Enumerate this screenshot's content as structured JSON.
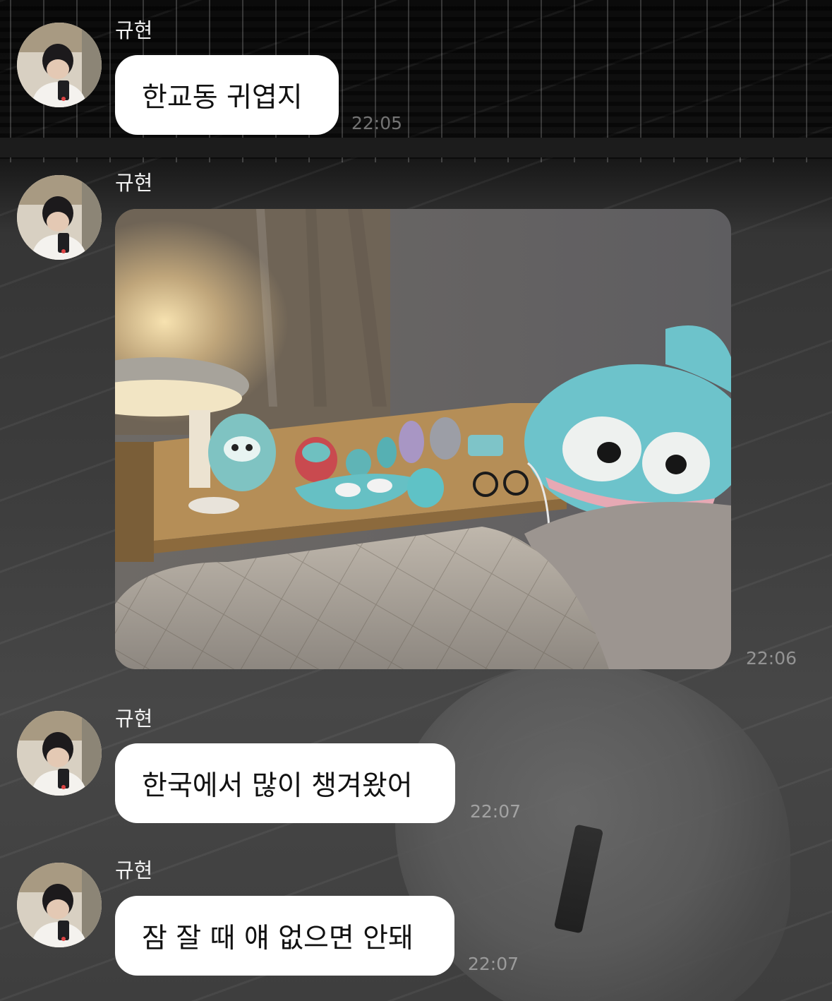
{
  "messages": [
    {
      "sender": "규현",
      "type": "text",
      "text": "한교동 귀엽지",
      "time": "22:05"
    },
    {
      "sender": "규현",
      "type": "image",
      "image_desc": "photo",
      "time": "22:06"
    },
    {
      "sender": "규현",
      "type": "text",
      "text": "한국에서 많이 챙겨왔어",
      "time": "22:07"
    },
    {
      "sender": "규현",
      "type": "text",
      "text": "잠 잘 때 얘 없으면 안돼",
      "time": "22:07"
    }
  ],
  "colors": {
    "bubble": "#ffffff",
    "bubble_text": "#111111",
    "name_text": "#f2f2f2",
    "time_text": "rgba(255,255,255,0.42)"
  },
  "icons": [
    "profile-avatar"
  ]
}
